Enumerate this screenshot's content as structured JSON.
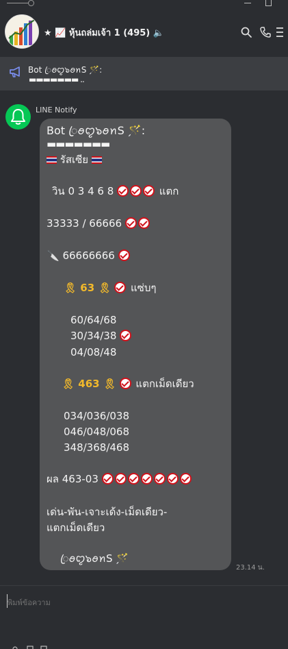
{
  "header": {
    "title": "★ 📈 หุ้นถล่มเจ้า 1 (495) 🔈"
  },
  "announcement": {
    "line1": "Bot  ꦿ️ꪮꨄ๖ꪮꪀS 🪄:",
    "line2": "▬▬▬▬▬▬▬ .."
  },
  "message": {
    "sender": "LINE Notify",
    "time": "23.14 น.",
    "lines": [
      "Bot  ꦿ️ꪮꨄ๖ꪮꪀS 🪄:",
      "▬▬▬▬▬▬▬",
      "รัสเซีย",
      "วิน 0 3 4 6 8",
      "แตก",
      "33333 / 66666",
      "🔪 66666666",
      "🎗 63 🎗",
      "แซ่บๆ",
      "60/64/68",
      "30/34/38",
      "04/08/48",
      "🎗 463 🎗",
      "แตกเม็ดเดียว",
      "034/036/038",
      "046/048/068",
      "348/368/468",
      "ผล 463-03",
      "เด่น-พัน-เจาะเด้ง-เม็ดเดียว-",
      "แตกเม็ดเดียว",
      "ꦿ️ꪮꨄ๖ꪮꪀS 🪄"
    ]
  },
  "composer": {
    "placeholder": "พิมพ์ข้อความ"
  },
  "colors": {
    "background": "#2b2d31",
    "announcement": "#3c3e42",
    "bubble": "#545557",
    "line_green": "#06c755",
    "check_red": "#d0121b"
  }
}
